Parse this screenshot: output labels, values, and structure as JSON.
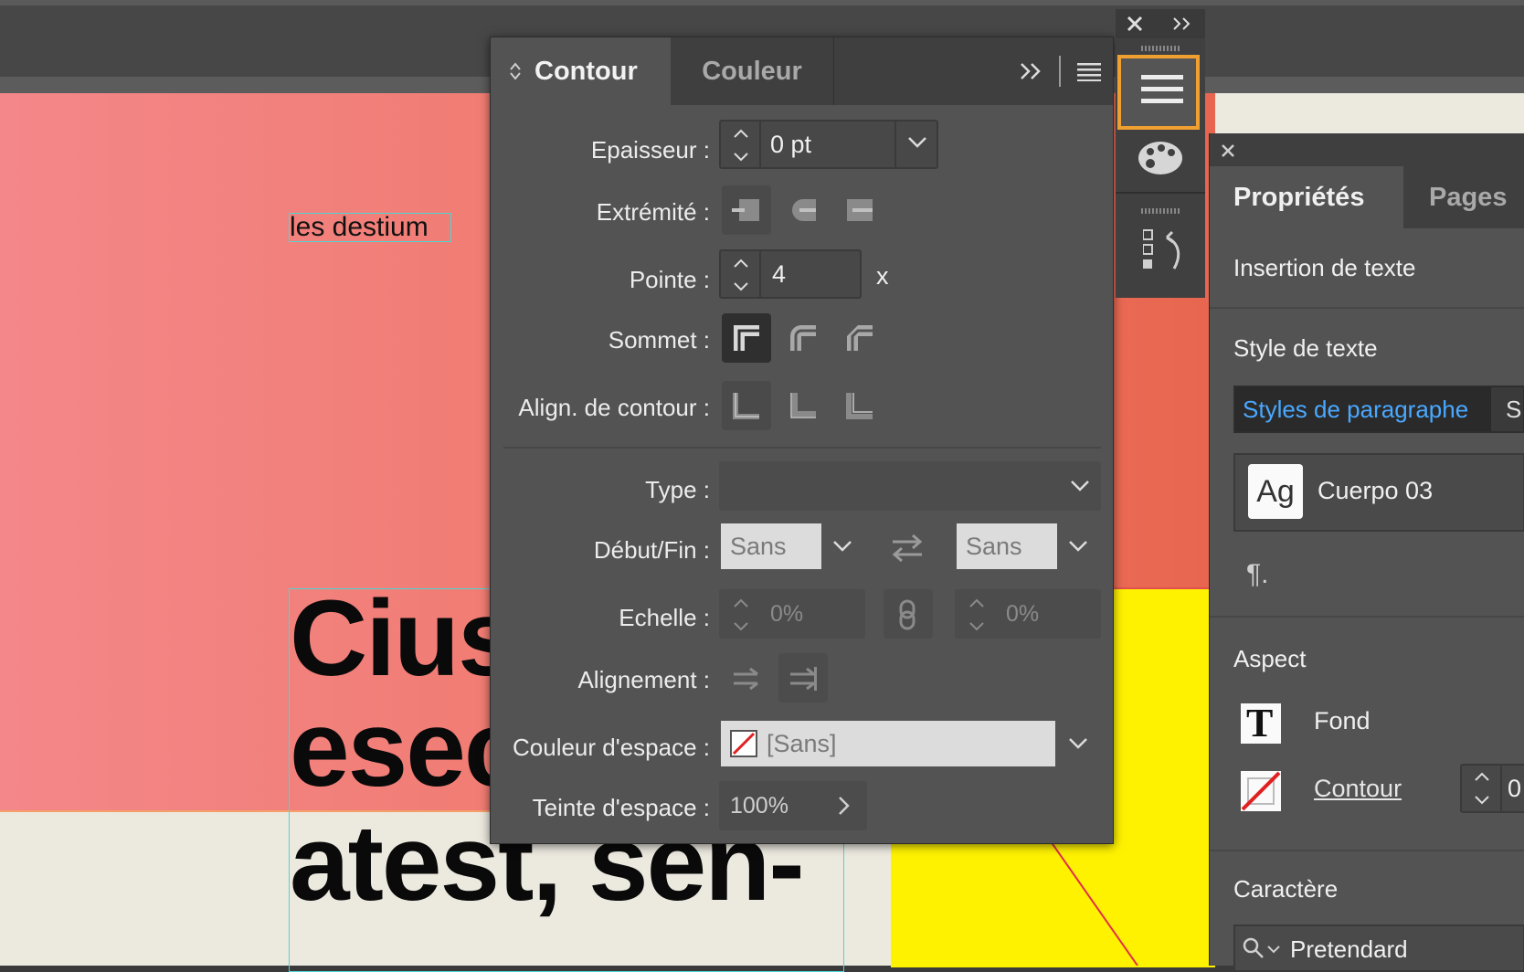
{
  "canvas": {
    "small_text": "les destium",
    "big_text": [
      "Cius",
      "esec",
      "atest, sen-"
    ]
  },
  "contour_panel": {
    "tabs": [
      "Contour",
      "Couleur"
    ],
    "labels": {
      "epaisseur": "Epaisseur :",
      "extremite": "Extrémité :",
      "pointe": "Pointe :",
      "sommet": "Sommet :",
      "align": "Align. de contour :",
      "type": "Type :",
      "debut_fin": "Début/Fin :",
      "echelle": "Echelle :",
      "alignement": "Alignement :",
      "couleur_espace": "Couleur d'espace :",
      "teinte_espace": "Teinte d'espace :"
    },
    "values": {
      "epaisseur": "0 pt",
      "pointe": "4",
      "pointe_unit": "x",
      "type": "",
      "debut": "Sans",
      "fin": "Sans",
      "echelle_debut": "0%",
      "echelle_fin": "0%",
      "couleur_espace": "[Sans]",
      "teinte_espace": "100%"
    }
  },
  "properties_panel": {
    "tabs": [
      "Propriétés",
      "Pages"
    ],
    "insertion": "Insertion de texte",
    "style_de_texte": "Style de texte",
    "style_tabs": [
      "Styles de paragraphe",
      "S"
    ],
    "style_preview": "Ag",
    "style_name": "Cuerpo 03",
    "pilcrow": "¶.",
    "aspect": "Aspect",
    "fond": "Fond",
    "contour": "Contour",
    "contour_value": "0",
    "caractere": "Caractère",
    "font_name": "Pretendard"
  },
  "colors": {
    "accent_highlight": "#f0a030",
    "link_blue": "#4aa8ff",
    "canvas_yellow": "#fff200",
    "canvas_pink": "#f4878a"
  }
}
